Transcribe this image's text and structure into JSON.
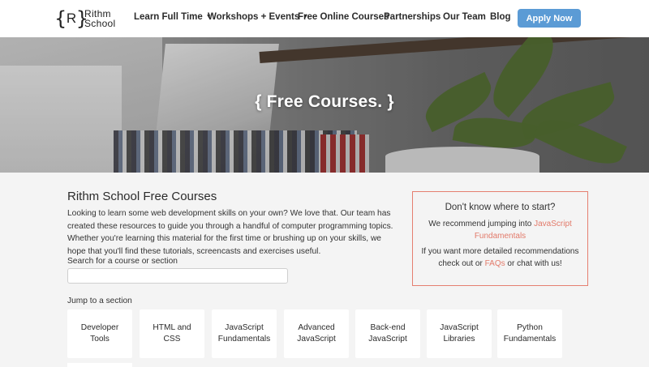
{
  "nav": {
    "logo_bracket_left": "{",
    "logo_letter": "R",
    "logo_bracket_right": "}",
    "logo_line1": "Rithm",
    "logo_line2": "School",
    "items": [
      {
        "label": "Learn Full Time",
        "dropdown": true
      },
      {
        "label": "Workshops + Events",
        "dropdown": true
      },
      {
        "label": "Free Online Courses",
        "dropdown": false
      },
      {
        "label": "Partnerships",
        "dropdown": false
      },
      {
        "label": "Our Team",
        "dropdown": false
      },
      {
        "label": "Blog",
        "dropdown": false
      }
    ],
    "caret": "▼",
    "apply_label": "Apply Now",
    "accent_color": "#5b9bd5"
  },
  "hero": {
    "title": "{ Free Courses. }"
  },
  "main": {
    "title": "Rithm School Free Courses",
    "intro": "Looking to learn some web development skills on your own? We love that. Our team has created these resources to guide you through a handful of computer programming topics. Whether you're learning this material for the first time or brushing up on your skills, we hope that you'll find these tutorials, screencasts and exercises useful.",
    "search_label": "Search for a course or section",
    "search_value": "",
    "jump_label": "Jump to a section",
    "sections": [
      "Developer Tools",
      "HTML and CSS",
      "JavaScript Fundamentals",
      "Advanced JavaScript",
      "Back-end JavaScript",
      "JavaScript Libraries",
      "Python Fundamentals"
    ]
  },
  "callout": {
    "title": "Don't know where to start?",
    "p1_prefix": "We recommend jumping into ",
    "p1_link": "JavaScript Fundamentals",
    "p2_prefix": "If you want more detailed recommendations check out or ",
    "p2_link": "FAQs",
    "p2_suffix": " or chat with us!",
    "border_color": "#e57f70",
    "link_color": "#e27a6a"
  }
}
